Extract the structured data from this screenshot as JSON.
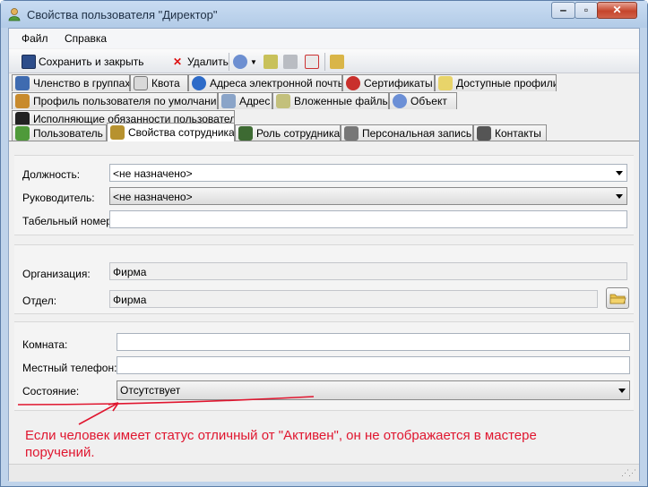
{
  "window": {
    "title": "Свойства пользователя \"Директор\""
  },
  "menu": {
    "file": "Файл",
    "help": "Справка"
  },
  "toolbar": {
    "save_close": "Сохранить и закрыть",
    "delete": "Удалить"
  },
  "tabs": {
    "row1": [
      "Членство в группах",
      "Квота",
      "Адреса электронной почты",
      "Сертификаты",
      "Доступные профили"
    ],
    "row2": [
      "Профиль пользователя по умолчанию",
      "Адрес",
      "Вложенные файлы",
      "Объект"
    ],
    "row3": [
      "Исполняющие обязанности пользователи"
    ],
    "row4": [
      "Пользователь",
      "Свойства сотрудника",
      "Роль сотрудника",
      "Персональная запись",
      "Контакты"
    ]
  },
  "form": {
    "position_label": "Должность:",
    "position_value": "<не назначено>",
    "manager_label": "Руководитель:",
    "manager_value": "<не назначено>",
    "personnel_label": "Табельный номер:",
    "personnel_value": "",
    "org_label": "Организация:",
    "org_value": "Фирма",
    "dept_label": "Отдел:",
    "dept_value": "Фирма",
    "room_label": "Комната:",
    "room_value": "",
    "phone_label": "Местный телефон:",
    "phone_value": "",
    "state_label": "Состояние:",
    "state_value": "Отсутствует"
  },
  "annotation": {
    "note": "Если человек имеет статус отличный от \"Активен\", он не отображается в мастере поручений.",
    "color": "#e0162f"
  }
}
